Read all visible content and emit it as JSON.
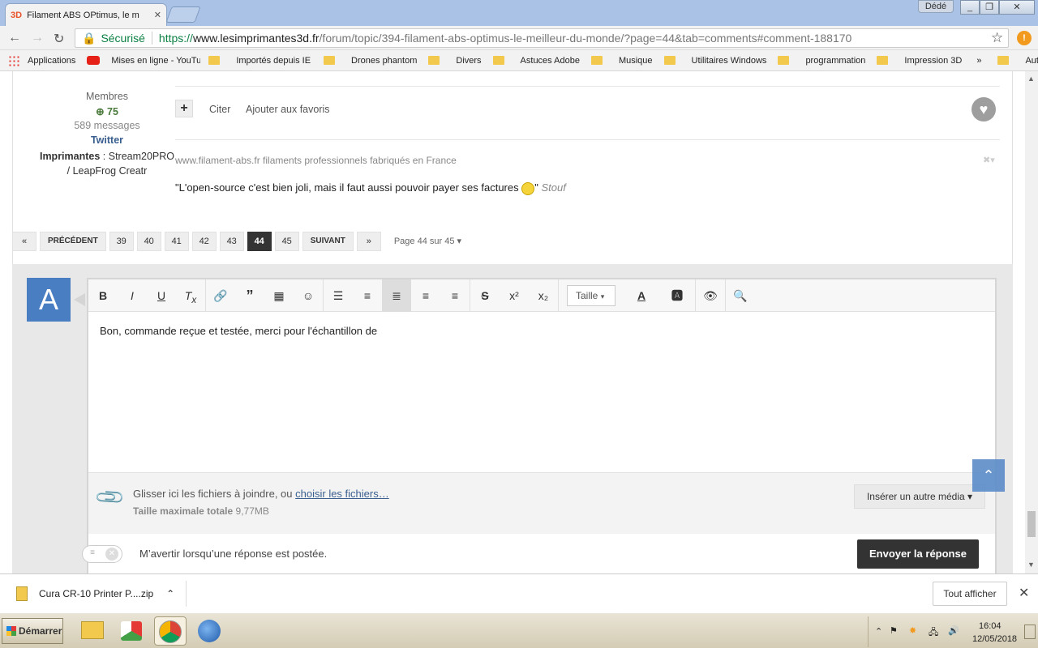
{
  "browser": {
    "tab_title": "Filament ABS OPtimus, le m",
    "tab_favicon": "3D",
    "user_name": "Dédé",
    "secure_label": "Sécurisé",
    "url_scheme": "https://",
    "url_host": "www.lesimprimantes3d.fr",
    "url_path": "/forum/topic/394-filament-abs-optimus-le-meilleur-du-monde/?page=44&tab=comments#comment-188170"
  },
  "bookmarks": {
    "items": [
      "Applications",
      "Mises en ligne - YouTu",
      "Importés depuis IE",
      "Drones phantom",
      "Divers",
      "Astuces Adobe",
      "Musique",
      "Utilitaires Windows",
      "programmation",
      "Impression 3D"
    ],
    "more": "»",
    "other": "Autres favoris"
  },
  "post": {
    "role": "Membres",
    "reputation": "75",
    "messages": "589 messages",
    "twitter": "Twitter",
    "printers_label": "Imprimantes",
    "printers_value": " : Stream20PRO / LeapFrog Creatr",
    "quote_label": "Citer",
    "favorite_label": "Ajouter aux favoris",
    "signature_line1": "www.filament-abs.fr filaments professionnels fabriqués en France",
    "signature_quote": "\"L'open-source c'est bien joli, mais il faut aussi pouvoir payer ses factures ",
    "signature_quote_end": "\"",
    "signature_author": "Stouf"
  },
  "pagination": {
    "first": "«",
    "prev": "PRÉCÉDENT",
    "pages": [
      "39",
      "40",
      "41",
      "42",
      "43",
      "44",
      "45"
    ],
    "current": "44",
    "next": "SUIVANT",
    "last": "»",
    "summary": "Page 44 sur 45"
  },
  "editor": {
    "avatar_letter": "A",
    "size_label": "Taille",
    "content": "Bon, commande reçue et testée, merci pour l'échantillon de",
    "drop_text": "Glisser ici les fichiers à joindre, ou ",
    "choose_files": "choisir les fichiers…",
    "max_size_label": "Taille maximale totale",
    "max_size_value": "9,77MB",
    "insert_media": "Insérer un autre média",
    "notify_label": "M’avertir lorsqu’une réponse est postée.",
    "submit": "Envoyer la réponse"
  },
  "downloads": {
    "file": "Cura CR-10 Printer P....zip",
    "show_all": "Tout afficher"
  },
  "taskbar": {
    "start": "Démarrer",
    "time": "16:04",
    "date": "12/05/2018"
  }
}
